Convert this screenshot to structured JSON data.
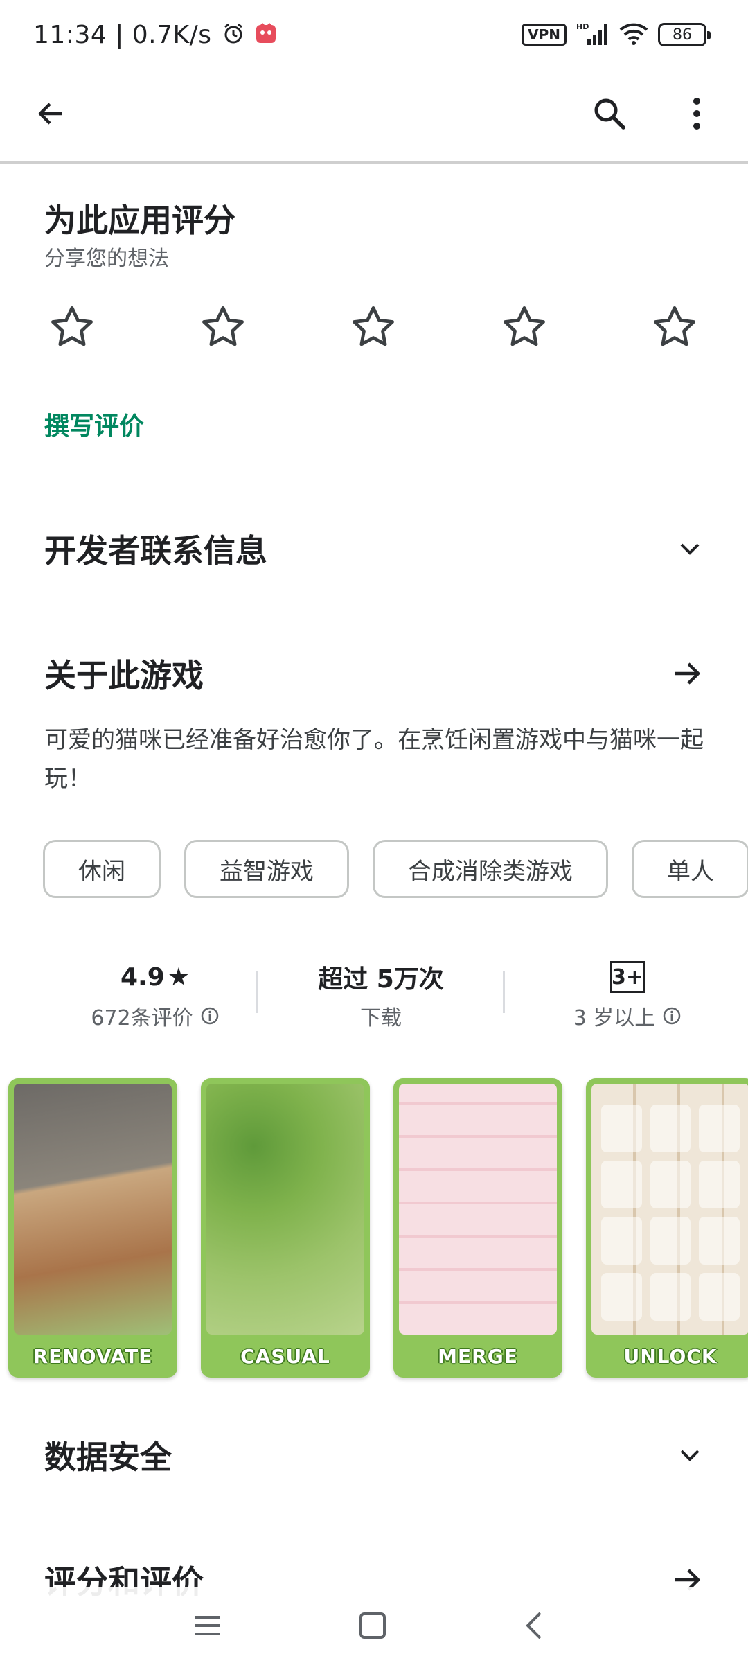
{
  "status_bar": {
    "time_speed": "11:34 | 0.7K/s",
    "vpn": "VPN",
    "network": "HD",
    "battery": "86"
  },
  "rate": {
    "title": "为此应用评分",
    "subtitle": "分享您的想法",
    "stars": 5,
    "write_review": "撰写评价"
  },
  "developer_contact": {
    "title": "开发者联系信息"
  },
  "about": {
    "title": "关于此游戏",
    "description": "可爱的猫咪已经准备好治愈你了。在烹饪闲置游戏中与猫咪一起玩！"
  },
  "tags": [
    "休闲",
    "益智游戏",
    "合成消除类游戏",
    "单人"
  ],
  "stats": {
    "rating_value": "4.9",
    "rating_star": "★",
    "rating_count": "672条评价",
    "downloads": "超过 5万次",
    "downloads_label": "下载",
    "age_badge": "3+",
    "age_label": "3 岁以上"
  },
  "screenshots": [
    {
      "label": "RENOVATE"
    },
    {
      "label": "CASUAL"
    },
    {
      "label": "MERGE"
    },
    {
      "label": "UNLOCK"
    }
  ],
  "data_safety": {
    "title": "数据安全"
  },
  "ratings_reviews": {
    "title": "评分和评价"
  },
  "colors": {
    "accent": "#01875f",
    "text_primary": "#202124",
    "text_secondary": "#5f6368",
    "chip_border": "#c4c7c5"
  }
}
